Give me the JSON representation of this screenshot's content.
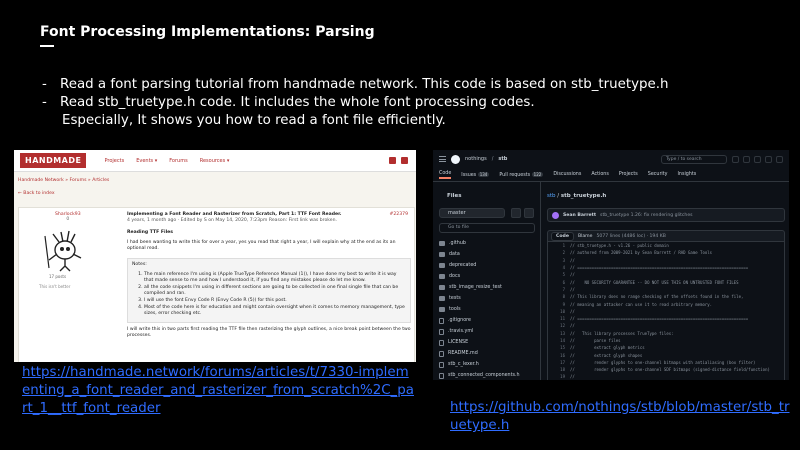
{
  "slide": {
    "title": "Font Processing Implementations: Parsing",
    "bullets": [
      {
        "dash": "-",
        "text": "Read a font parsing tutorial from handmade network. This code is based on stb_truetype.h"
      },
      {
        "dash": "-",
        "text": "Read stb_truetype.h code. It includes the whole font processing codes.",
        "cont": "Especially, It shows you how to read a font file efficiently."
      }
    ],
    "link_left": "https://handmade.network/forums/articles/t/7330-implementing_a_font_reader_and_rasterizer_from_scratch%2C_part_1__ttf_font_reader",
    "link_right": "https://github.com/nothings/stb/blob/master/stb_truetype.h"
  },
  "handmade": {
    "logo": "HANDMADE",
    "nav": [
      "Projects",
      "Events ▾",
      "Forums",
      "Resources ▾"
    ],
    "breadcrumb": "Handmade Network » Forums » Articles",
    "back": "← Back to index",
    "username": "Sharlock93",
    "rank": "0",
    "posts": "17 posts",
    "joined": "This isn't better",
    "post_id": "#22379",
    "post_title": "Implementing a Font Reader and Rasterizer from Scratch, Part 1: TTF Font Reader.",
    "post_meta": "4 years, 1 month ago · Edited by S on May 14, 2020, 7:23pm Reason: First link was broken.",
    "section": "Reading TTF Files",
    "intro": "I had been wanting to write this for over a year, yes you read that right a year, I will explain why at the end as its an optional read.",
    "notes_label": "Notes:",
    "notes": [
      "The main reference I'm using is (Apple TrueType Reference Manual (1)), I have done my best to write it is way that made sense to me and how I understood it, if you find any mistakes please do let me know.",
      "all the code snippets I'm using in different sections are going to be collected in one final single file that can be compiled and ran.",
      "I will use the font Envy Code R (Envy Code R (5)) for this post.",
      "Most of the code here is for education and might contain oversight when it comes to memory management, type sizes, error checking etc."
    ],
    "footer": "I will write this in two parts first reading the TTF file then rasterizing the glyph outlines, a nice break point between the two processes."
  },
  "github": {
    "owner": "nothings",
    "repo": "stb",
    "search_placeholder": "Type / to search",
    "tabs": [
      {
        "label": "Code",
        "active": true
      },
      {
        "label": "Issues",
        "count": "134"
      },
      {
        "label": "Pull requests",
        "count": "122"
      },
      {
        "label": "Discussions"
      },
      {
        "label": "Actions"
      },
      {
        "label": "Projects"
      },
      {
        "label": "Security"
      },
      {
        "label": "Insights"
      }
    ],
    "files_title": "Files",
    "branch": "master",
    "goto_placeholder": "Go to file",
    "tree": [
      {
        "name": ".github",
        "type": "dir"
      },
      {
        "name": "data",
        "type": "dir"
      },
      {
        "name": "deprecated",
        "type": "dir"
      },
      {
        "name": "docs",
        "type": "dir"
      },
      {
        "name": "stb_image_resize_test",
        "type": "dir"
      },
      {
        "name": "tests",
        "type": "dir"
      },
      {
        "name": "tools",
        "type": "dir"
      },
      {
        "name": ".gitignore",
        "type": "file"
      },
      {
        "name": ".travis.yml",
        "type": "file"
      },
      {
        "name": "LICENSE",
        "type": "file"
      },
      {
        "name": "README.md",
        "type": "file"
      },
      {
        "name": "stb_c_lexer.h",
        "type": "file"
      },
      {
        "name": "stb_connected_components.h",
        "type": "file"
      }
    ],
    "path_repo": "stb",
    "path_file": "stb_truetype.h",
    "commit_author": "Sean Barrett",
    "commit_msg": "stb_truetype 1.26: fix rendering glitches",
    "code_tab": "Code",
    "blame_tab": "Blame",
    "file_info": "5077 lines (4486 loc) · 194 KB",
    "code_lines": [
      "// stb_truetype.h - v1.26 - public domain",
      "// authored from 2009-2021 by Sean Barrett / RAD Game Tools",
      "//",
      "// =======================================================================",
      "//",
      "//    NO SECURITY GUARANTEE -- DO NOT USE THIS ON UNTRUSTED FONT FILES",
      "//",
      "// This library does no range checking of the offsets found in the file,",
      "// meaning an attacker can use it to read arbitrary memory.",
      "//",
      "// =======================================================================",
      "//",
      "//   This library processes TrueType files:",
      "//        parse files",
      "//        extract glyph metrics",
      "//        extract glyph shapes",
      "//        render glyphs to one-channel bitmaps with antialiasing (box filter)",
      "//        render glyphs to one-channel SDF bitmaps (signed-distance field/function)",
      "//"
    ]
  }
}
